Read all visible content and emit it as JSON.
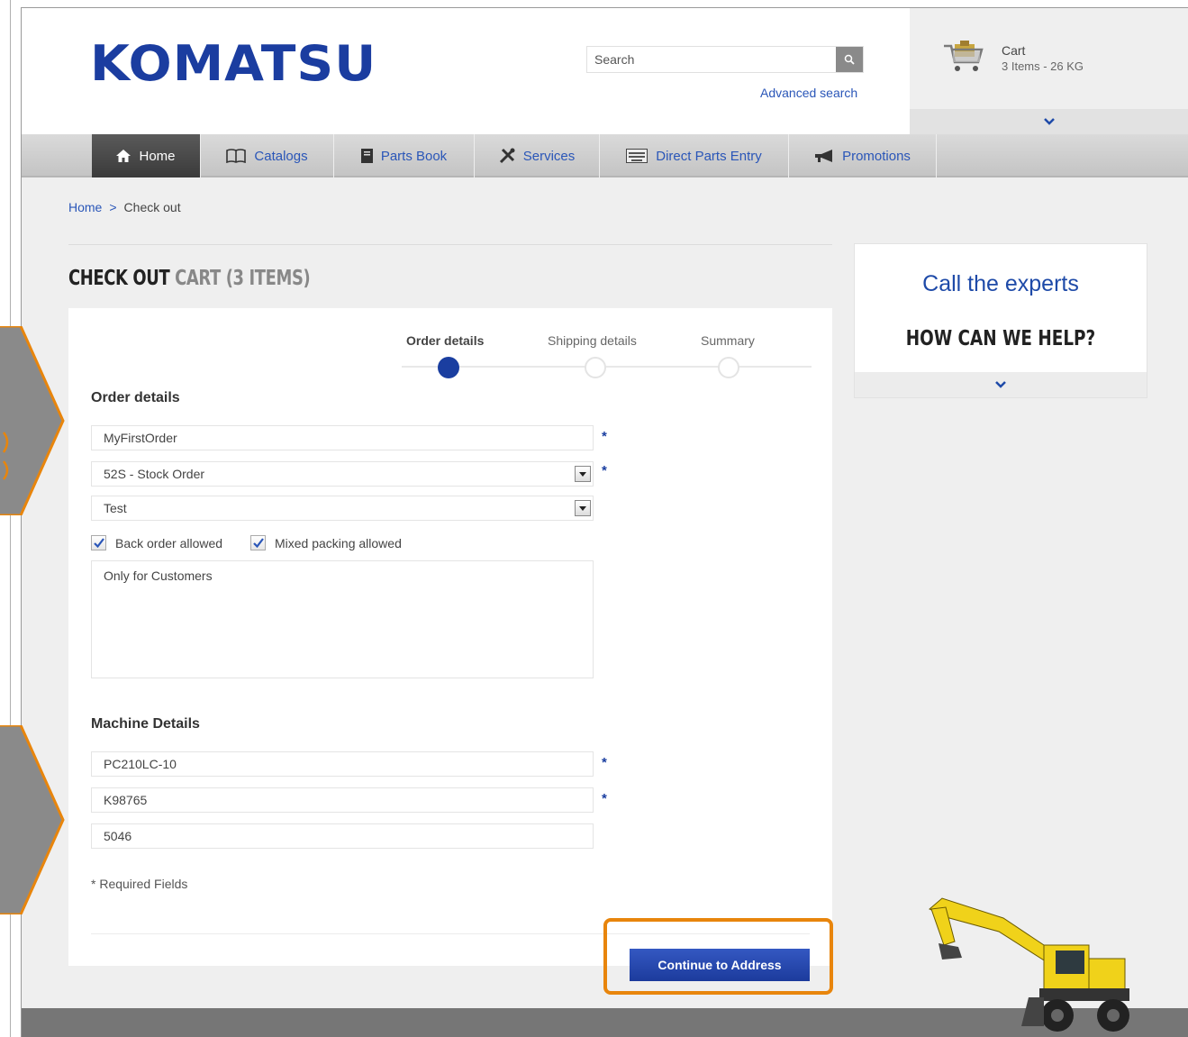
{
  "header": {
    "logo_text": "KOMATSU",
    "search_placeholder": "Search",
    "advanced_search": "Advanced search",
    "cart_title": "Cart",
    "cart_summary": "3 Items - 26 KG"
  },
  "nav": {
    "items": [
      {
        "label": "Home",
        "icon": "home-icon"
      },
      {
        "label": "Catalogs",
        "icon": "book-icon"
      },
      {
        "label": "Parts Book",
        "icon": "document-icon"
      },
      {
        "label": "Services",
        "icon": "tools-icon"
      },
      {
        "label": "Direct Parts Entry",
        "icon": "keyboard-icon"
      },
      {
        "label": "Promotions",
        "icon": "megaphone-icon"
      }
    ]
  },
  "breadcrumb": {
    "home": "Home",
    "separator": ">",
    "current": "Check out"
  },
  "page_title": {
    "main": "CHECK OUT",
    "sub": "CART (3 ITEMS)"
  },
  "steps": [
    {
      "label": "Order details",
      "active": true
    },
    {
      "label": "Shipping details",
      "active": false
    },
    {
      "label": "Summary",
      "active": false
    }
  ],
  "order_details": {
    "heading": "Order details",
    "order_name": "MyFirstOrder",
    "order_type": "52S - Stock Order",
    "order_option": "Test",
    "back_order_label": "Back order allowed",
    "back_order_checked": true,
    "mixed_packing_label": "Mixed packing allowed",
    "mixed_packing_checked": true,
    "comments": "Only for Customers",
    "required_marker": "*"
  },
  "machine_details": {
    "heading": "Machine Details",
    "model": "PC210LC-10",
    "serial": "K98765",
    "hours": "5046"
  },
  "required_note": "* Required Fields",
  "continue_label": "Continue to Address",
  "experts": {
    "title": "Call the experts",
    "subtitle": "HOW CAN WE HELP?"
  },
  "colors": {
    "brand_blue": "#1b3da0",
    "link_blue": "#2a56b8",
    "highlight_orange": "#e8850c",
    "annotation_gray": "#8a8a8a"
  }
}
